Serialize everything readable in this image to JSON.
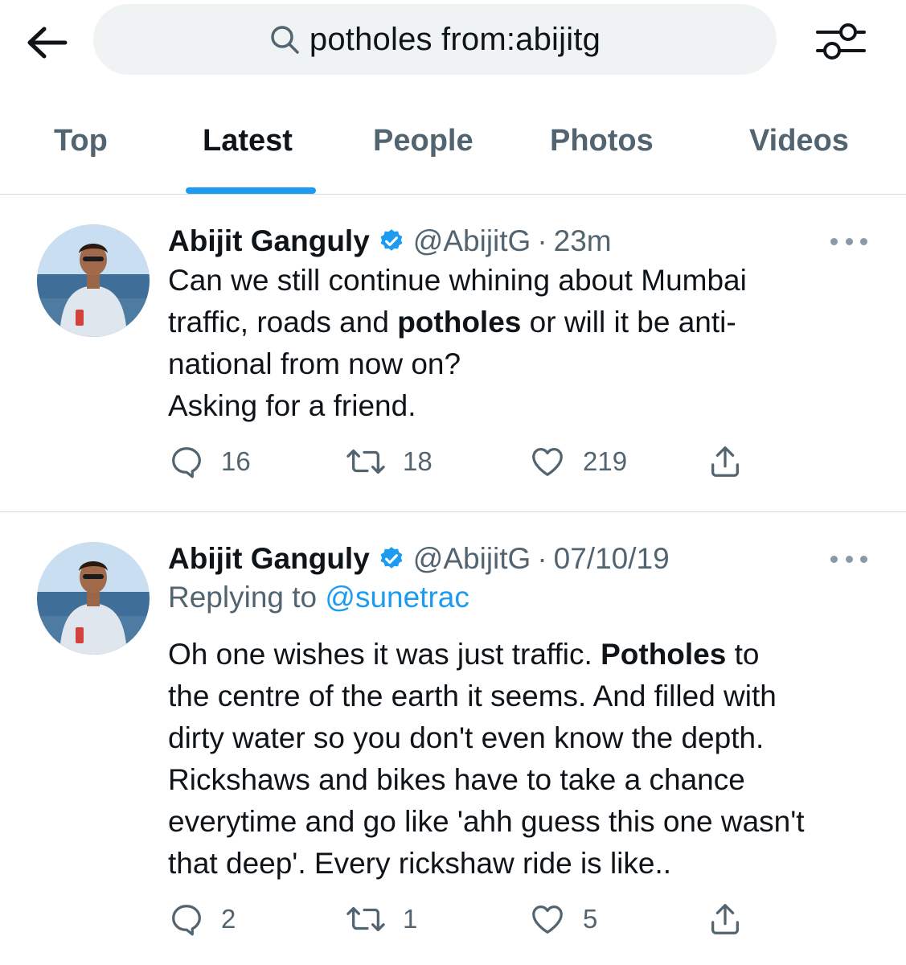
{
  "search": {
    "query": "potholes from:abijitg"
  },
  "icons": {
    "back": "arrow-left-icon",
    "search": "search-icon",
    "filter": "filter-sliders-icon",
    "verified": "verified-badge-icon",
    "more": "more-dots-icon",
    "reply": "reply-icon",
    "retweet": "retweet-icon",
    "like": "heart-icon",
    "share": "share-icon"
  },
  "colors": {
    "accent": "#1d9bf0",
    "muted": "#536471",
    "text": "#0f1419",
    "search_bg": "#eff3f4"
  },
  "tabs": [
    {
      "label": "Top",
      "active": false
    },
    {
      "label": "Latest",
      "active": true
    },
    {
      "label": "People",
      "active": false
    },
    {
      "label": "Photos",
      "active": false
    },
    {
      "label": "Videos",
      "active": false
    }
  ],
  "tweets": [
    {
      "name": "Abijit Ganguly",
      "handle": "@AbijitG",
      "separator": "·",
      "time": "23m",
      "lines": [
        [
          "Can we still continue whining about Mumbai"
        ],
        [
          "traffic, roads and ",
          "potholes",
          " or will it be anti-"
        ],
        [
          "national from now on?"
        ],
        [
          "Asking for a friend."
        ]
      ],
      "replies": "16",
      "retweets": "18",
      "likes": "219"
    },
    {
      "name": "Abijit Ganguly",
      "handle": "@AbijitG",
      "separator": "·",
      "time": "07/10/19",
      "replying_prefix": "Replying to ",
      "replying_to": "@sunetrac",
      "lines": [
        [
          "Oh one wishes it was just traffic. ",
          "Potholes",
          " to"
        ],
        [
          "the centre of the earth it seems. And filled with"
        ],
        [
          "dirty water so you don't even know the depth."
        ],
        [
          "Rickshaws and bikes have to take a chance"
        ],
        [
          "everytime and go like 'ahh guess this one wasn't"
        ],
        [
          "that deep'. Every rickshaw ride is like.."
        ]
      ],
      "replies": "2",
      "retweets": "1",
      "likes": "5"
    }
  ]
}
